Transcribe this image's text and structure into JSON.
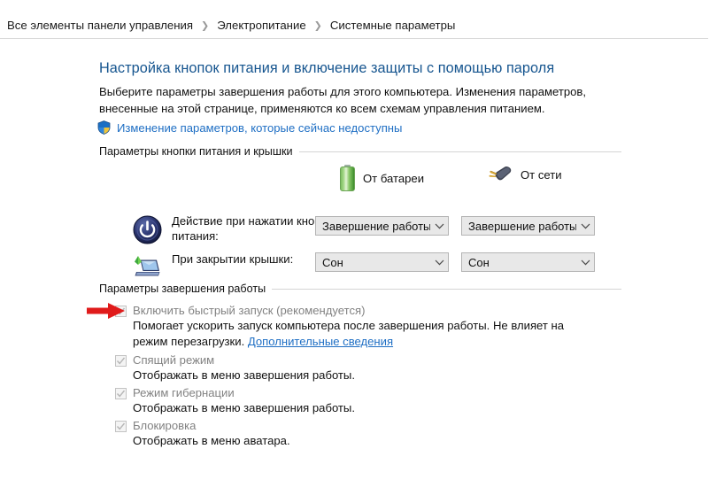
{
  "breadcrumb": {
    "separator": "❯",
    "items": [
      {
        "label": "Все элементы панели управления"
      },
      {
        "label": "Электропитание"
      },
      {
        "label": "Системные параметры"
      }
    ]
  },
  "page": {
    "title": "Настройка кнопок питания и включение защиты с помощью пароля",
    "description": "Выберите параметры завершения работы для этого компьютера. Изменения параметров, внесенные на этой странице, применяются ко всем схемам управления питанием.",
    "uac_link": "Изменение параметров, которые сейчас недоступны",
    "uac_icon": "shield-icon"
  },
  "groups": {
    "power_buttons": {
      "title": "Параметры кнопки питания и крышки",
      "columns": [
        {
          "label": "От батареи",
          "icon": "battery-icon"
        },
        {
          "label": "От сети",
          "icon": "power-plug-icon"
        }
      ],
      "rows": [
        {
          "icon": "power-button-icon",
          "label": "Действие при нажатии кнопки питания:",
          "battery_value": "Завершение работы",
          "mains_value": "Завершение работы"
        },
        {
          "icon": "laptop-lid-icon",
          "label": "При закрытии крышки:",
          "battery_value": "Сон",
          "mains_value": "Сон"
        }
      ]
    },
    "shutdown_settings": {
      "title": "Параметры завершения работы",
      "items": [
        {
          "label": "Включить быстрый запуск (рекомендуется)",
          "checked": true,
          "disabled": true,
          "description": "Помогает ускорить запуск компьютера после завершения работы. Не влияет на режим перезагрузки. ",
          "link": "Дополнительные сведения"
        },
        {
          "label": "Спящий режим",
          "checked": true,
          "disabled": true,
          "description": "Отображать в меню завершения работы.",
          "link": ""
        },
        {
          "label": "Режим гибернации",
          "checked": true,
          "disabled": true,
          "description": "Отображать в меню завершения работы.",
          "link": ""
        },
        {
          "label": "Блокировка",
          "checked": true,
          "disabled": true,
          "description": "Отображать в меню аватара.",
          "link": ""
        }
      ]
    }
  },
  "annotation": {
    "type": "red-arrow",
    "points_to": "Включить быстрый запуск (рекомендуется)",
    "color": "#e01b1b"
  },
  "colors": {
    "title_blue": "#16558f",
    "link_blue": "#1f6fc4",
    "disabled_label": "#828282",
    "combo_bg": "#e8e8e8",
    "combo_border": "#b4b4b4",
    "rule": "#d9d9d9",
    "annotation_red": "#e01b1b"
  }
}
